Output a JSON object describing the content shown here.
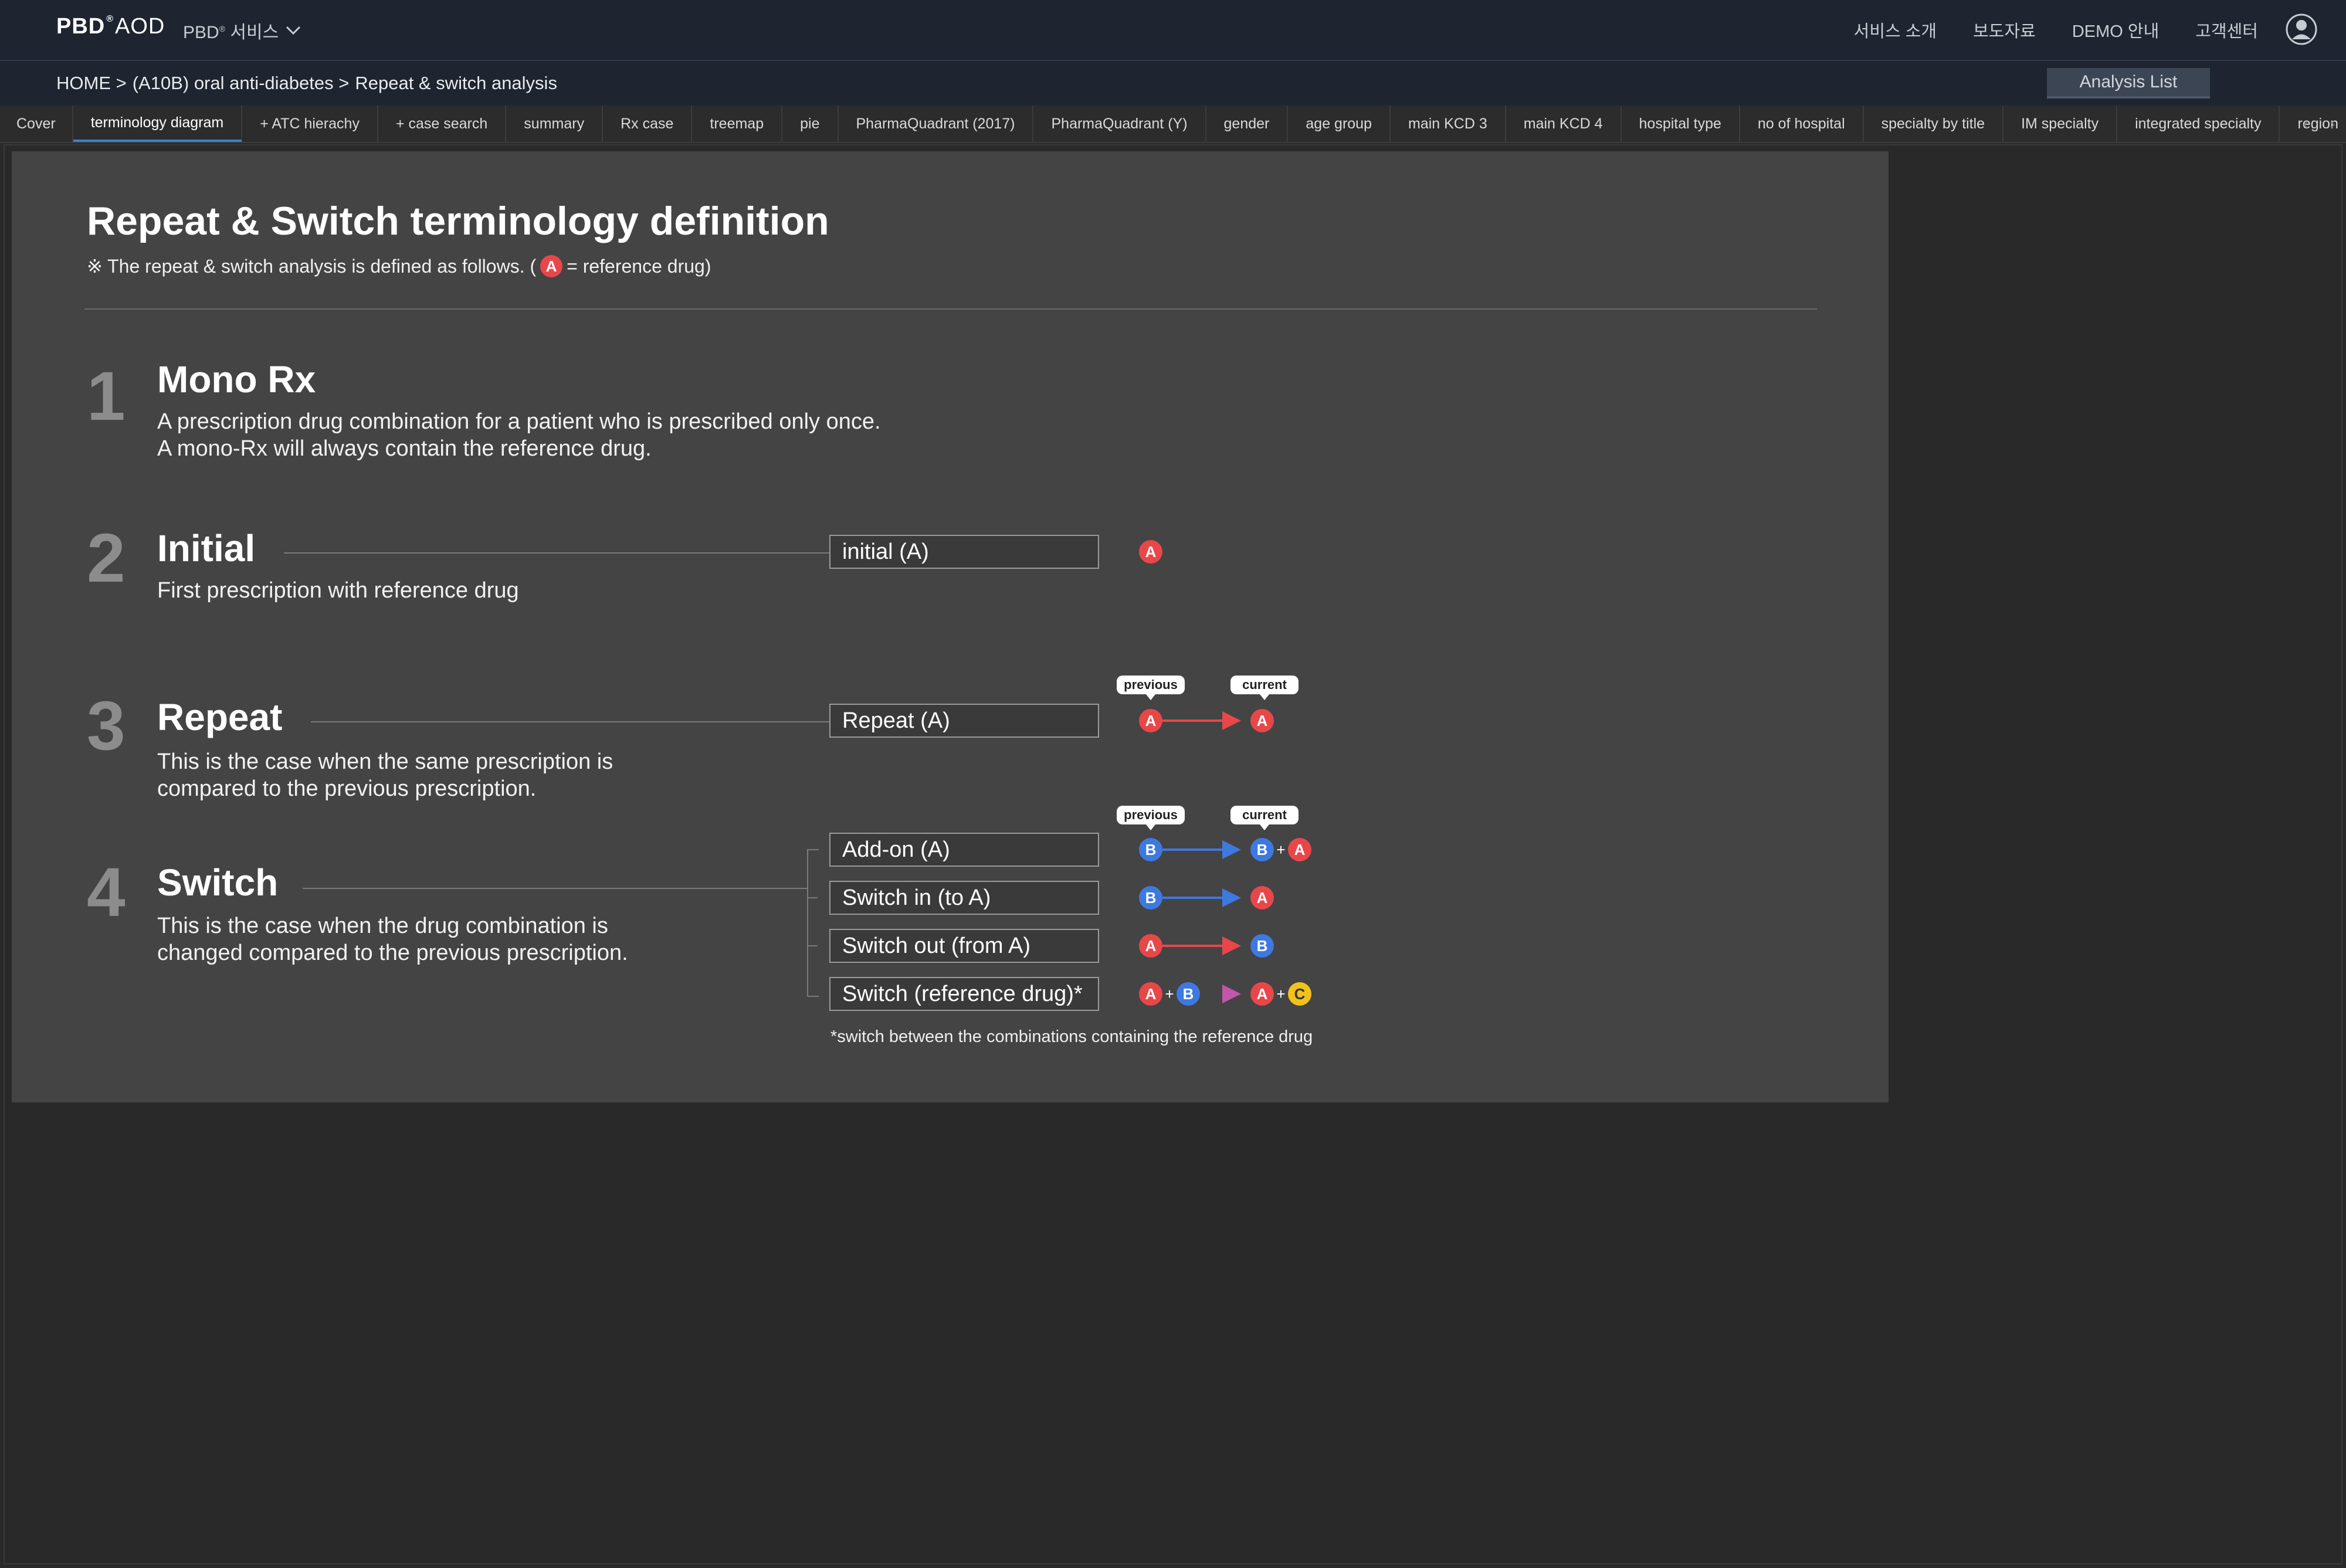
{
  "header": {
    "logo_main": "PBD",
    "logo_sup": "®",
    "logo_sub": "AOD",
    "service_menu": "PBD",
    "service_menu_sup": "®",
    "service_menu_suffix": "서비스",
    "links": [
      "서비스 소개",
      "보도자료",
      "DEMO 안내",
      "고객센터"
    ]
  },
  "breadcrumb": {
    "home": "HOME >",
    "category": "(A10B) oral anti-diabetes >",
    "current": "Repeat & switch analysis"
  },
  "analysis_list_label": "Analysis List",
  "tabs": [
    "Cover",
    "terminology diagram",
    "+ ATC hierachy",
    "+ case search",
    "summary",
    "Rx case",
    "treemap",
    "pie",
    "PharmaQuadrant (2017)",
    "PharmaQuadrant (Y)",
    "gender",
    "age group",
    "main KCD 3",
    "main KCD 4",
    "hospital type",
    "no of hospital",
    "specialty by title",
    "IM specialty",
    "integrated specialty",
    "region"
  ],
  "active_tab": "terminology diagram",
  "content": {
    "title": "Repeat & Switch terminology definition",
    "subtitle_prefix": "※ The repeat & switch analysis is defined as follows. (",
    "subtitle_suffix": "= reference drug)",
    "sections": [
      {
        "num": "1",
        "title": "Mono Rx",
        "desc": [
          "A prescription drug combination for a patient who is prescribed only once.",
          "A mono-Rx will always contain the reference drug."
        ]
      },
      {
        "num": "2",
        "title": "Initial",
        "desc": [
          "First prescription with reference drug"
        ]
      },
      {
        "num": "3",
        "title": "Repeat",
        "desc": [
          "This is the case when the same prescription is",
          "compared to the previous prescription."
        ]
      },
      {
        "num": "4",
        "title": "Switch",
        "desc": [
          "This is the case when the drug combination is",
          "changed compared to the previous prescription."
        ]
      }
    ],
    "boxes": {
      "initial": "initial (A)",
      "repeat": "Repeat (A)",
      "addon": "Add-on (A)",
      "switch_in": "Switch in (to A)",
      "switch_out": "Switch out (from A)",
      "switch_ref": "Switch (reference drug)*"
    },
    "bubble_previous": "previous",
    "bubble_current": "current",
    "drug_letters": {
      "a": "A",
      "b": "B",
      "c": "C"
    },
    "plus": "+",
    "footnote": "*switch between the combinations containing the reference drug"
  },
  "colors": {
    "drug_a": "#e8474a",
    "drug_b": "#3e79e0",
    "drug_c": "#f3c21a",
    "active_tab": "#3f7fd0"
  }
}
